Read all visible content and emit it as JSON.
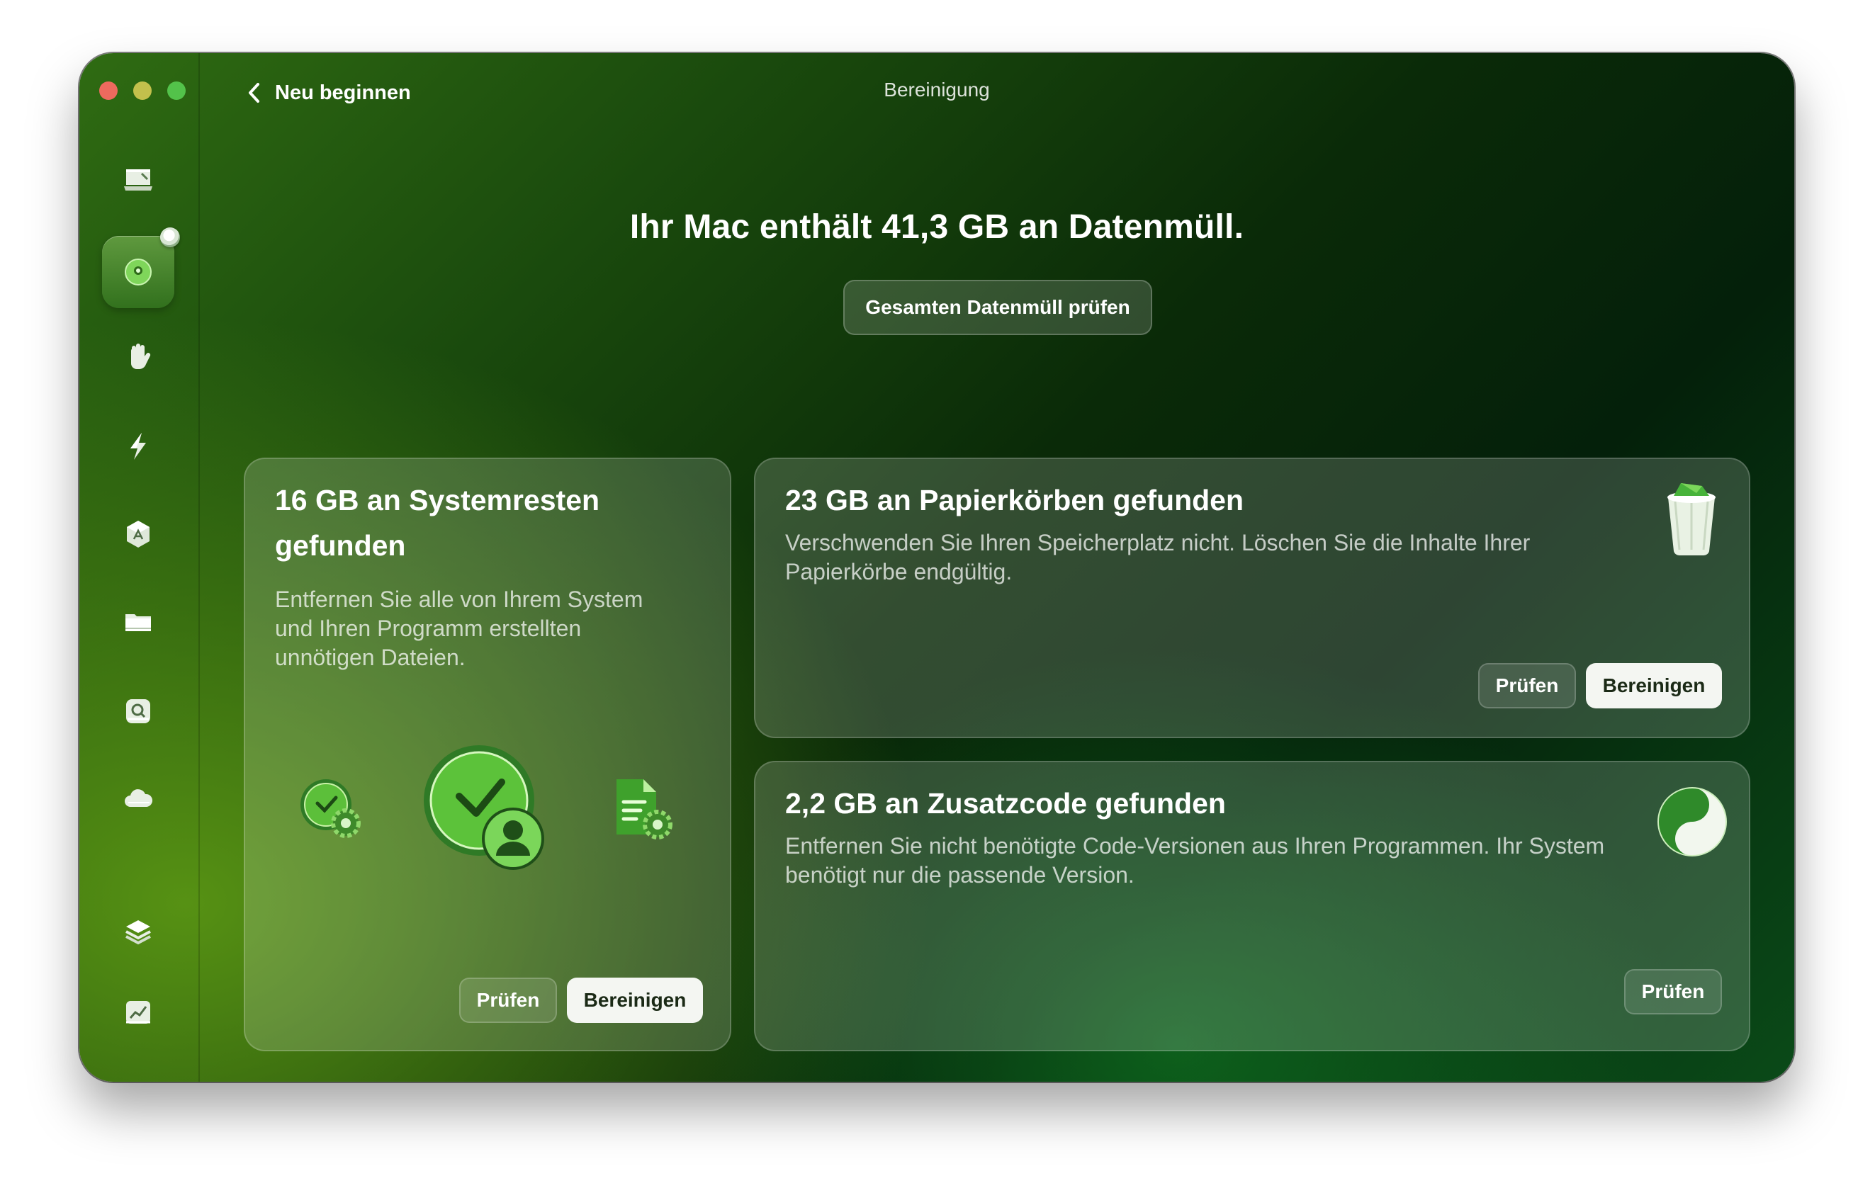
{
  "window": {
    "title": "Bereinigung",
    "back_label": "Neu beginnen"
  },
  "sidebar": {
    "items": [
      {
        "name": "smart-scan",
        "icon": "monitor-icon"
      },
      {
        "name": "cleanup",
        "icon": "cleanup-icon",
        "active": true
      },
      {
        "name": "protection",
        "icon": "hand-icon"
      },
      {
        "name": "performance",
        "icon": "lightning-icon"
      },
      {
        "name": "applications",
        "icon": "app-icon"
      },
      {
        "name": "my-clutter",
        "icon": "folder-icon"
      },
      {
        "name": "space-lens",
        "icon": "lens-icon"
      },
      {
        "name": "cloud",
        "icon": "cloud-icon"
      },
      {
        "name": "assistant",
        "icon": "layers-icon"
      },
      {
        "name": "menu",
        "icon": "chart-icon"
      }
    ]
  },
  "main": {
    "headline": "Ihr Mac enthält 41,3 GB an Datenmüll.",
    "review_all_label": "Gesamten Datenmüll prüfen"
  },
  "cards": {
    "system": {
      "title": "16 GB an Systemresten gefunden",
      "description": "Entfernen Sie alle von Ihrem System und Ihren Programm erstellten unnötigen Dateien.",
      "review_label": "Prüfen",
      "clean_label": "Bereinigen"
    },
    "trash": {
      "title": "23 GB an Papierkörben gefunden",
      "description": "Verschwenden Sie Ihren Speicherplatz nicht. Löschen Sie die Inhalte Ihrer Papierkörbe endgültig.",
      "review_label": "Prüfen",
      "clean_label": "Bereinigen"
    },
    "binaries": {
      "title": "2,2 GB an Zusatzcode gefunden",
      "description": "Entfernen Sie nicht benötigte Code-Versionen aus Ihren Programmen. Ihr System benötigt nur die passende Version.",
      "review_label": "Prüfen"
    }
  },
  "colors": {
    "accent_green": "#53c24a",
    "button_solid_bg": "#f4f6f2"
  }
}
